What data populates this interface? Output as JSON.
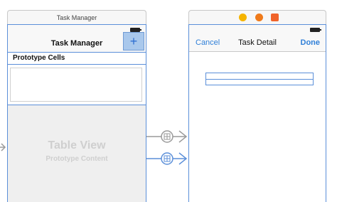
{
  "scene1": {
    "dock_title": "Task Manager",
    "nav_title": "Task Manager",
    "add_button_label": "+",
    "section_header": "Prototype Cells",
    "table_placeholder_title": "Table View",
    "table_placeholder_subtitle": "Prototype Content"
  },
  "scene2": {
    "dock_icons": [
      "view-controller-icon",
      "first-responder-icon",
      "exit-icon"
    ],
    "cancel_label": "Cancel",
    "nav_title": "Task Detail",
    "done_label": "Done"
  },
  "segues": {
    "count": 2,
    "selected_index": 1
  },
  "colors": {
    "selection_blue": "#5b8fd9",
    "button_blue": "#2f7fd8",
    "segue_gray": "#9a9a9a",
    "placeholder_text": "#cfcfcf"
  }
}
